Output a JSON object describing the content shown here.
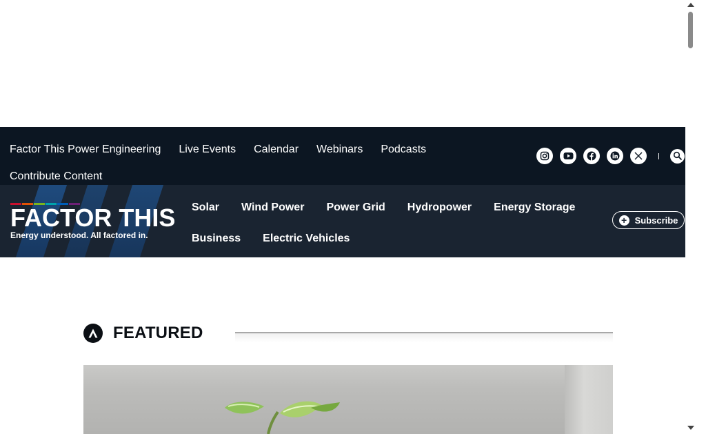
{
  "topbar": {
    "links": [
      {
        "label": "Factor This Power Engineering"
      },
      {
        "label": "Live Events"
      },
      {
        "label": "Calendar"
      },
      {
        "label": "Webinars"
      },
      {
        "label": "Podcasts"
      },
      {
        "label": "Contribute Content"
      }
    ],
    "social_icons": [
      "instagram-icon",
      "youtube-icon",
      "facebook-icon",
      "linkedin-icon",
      "x-icon"
    ],
    "search_icon": "search-icon",
    "background": "#0c1622"
  },
  "header": {
    "logo": {
      "wordmark": "FACTOR THIS",
      "registered": "™",
      "tagline": "Energy understood. All factored in.",
      "bar_colors": [
        "#c8102e",
        "#e35205",
        "#7ab51d",
        "#00a3ad",
        "#005eb8",
        "#6d2077"
      ]
    },
    "nav": [
      {
        "label": "Solar"
      },
      {
        "label": "Wind Power"
      },
      {
        "label": "Power Grid"
      },
      {
        "label": "Hydropower"
      },
      {
        "label": "Energy Storage"
      },
      {
        "label": "Business"
      },
      {
        "label": "Electric Vehicles"
      }
    ],
    "subscribe_label": "Subscribe",
    "background": "#1a2431"
  },
  "featured": {
    "title": "FEATURED"
  }
}
